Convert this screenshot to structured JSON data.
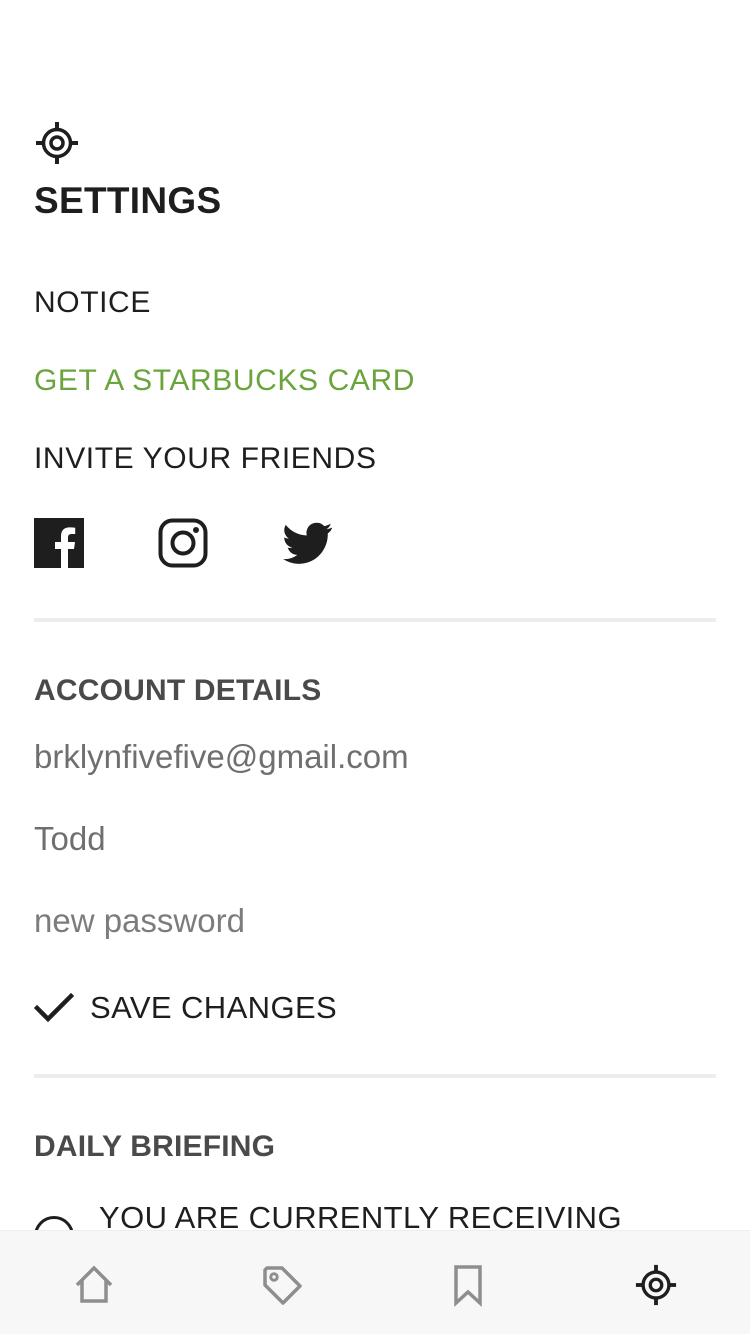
{
  "header": {
    "icon": "gear-icon",
    "title": "SETTINGS"
  },
  "menu": {
    "notice": "NOTICE",
    "starbucks": "GET A STARBUCKS CARD",
    "invite": "INVITE YOUR FRIENDS"
  },
  "social": [
    "facebook-icon",
    "instagram-icon",
    "twitter-icon"
  ],
  "account": {
    "title": "ACCOUNT DETAILS",
    "email_value": "brklynfivefive@gmail.com",
    "name_value": "Todd",
    "password_placeholder": "new password",
    "save_label": "SAVE CHANGES"
  },
  "briefing": {
    "title": "DAILY BRIEFING",
    "option_label": "YOU ARE CURRENTLY RECEIVING"
  },
  "tabbar": {
    "items": [
      "home-icon",
      "tag-icon",
      "bookmark-icon",
      "gear-icon"
    ],
    "active": "gear-icon"
  },
  "colors": {
    "accent_green": "#6aa43d",
    "text": "#1e1e1e",
    "muted": "#6f6f6f"
  }
}
